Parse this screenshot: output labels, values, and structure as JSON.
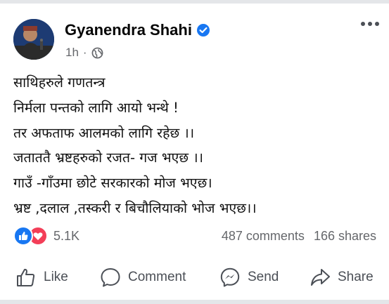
{
  "post": {
    "author": "Gyanendra Shahi",
    "time": "1h",
    "separator": "·",
    "body_lines": [
      "साथिहरुले गणतन्त्र",
      "निर्मला पन्तको लागि आयो भन्थे !",
      "तर अफताफ आलमको लागि रहेछ ।।",
      "जताततै भ्रष्टहरुको रजत-  गज भएछ ।।",
      "गाउँ -गाँउमा छोटे सरकारको मोज भएछ।",
      "भ्रष्ट ,दलाल ,तस्करी र बिचौलियाको भोज भएछ।।"
    ]
  },
  "stats": {
    "reactions_count": "5.1K",
    "comments": "487 comments",
    "shares": "166 shares"
  },
  "actions": {
    "like": "Like",
    "comment": "Comment",
    "send": "Send",
    "share": "Share"
  },
  "colors": {
    "accent": "#1877f2",
    "love": "#f33e58",
    "secondary_text": "#65676b"
  },
  "icons": [
    "verified-badge-icon",
    "globe-icon",
    "more-options-icon",
    "like-reaction-icon",
    "love-reaction-icon",
    "thumbs-up-icon",
    "comment-bubble-icon",
    "messenger-icon",
    "share-arrow-icon"
  ]
}
